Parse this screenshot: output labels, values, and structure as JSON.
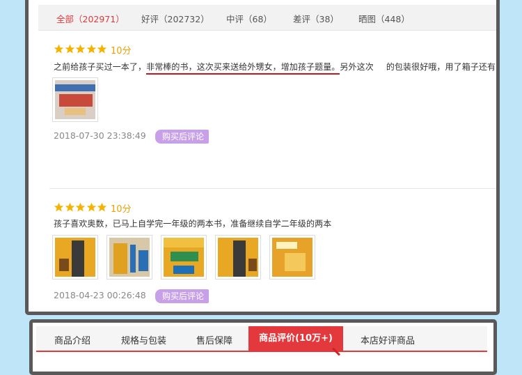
{
  "filters": [
    {
      "label": "全部（202971）",
      "active": true
    },
    {
      "label": "好评（202732）"
    },
    {
      "label": "中评（68）"
    },
    {
      "label": "差评（38）"
    },
    {
      "label": "晒图（448）"
    }
  ],
  "reviews": [
    {
      "score": "10分",
      "text_before": "之前给孩子买过一本了，",
      "text_highlight": "非常棒的书，这次买来送给外甥女，增加孩子题量。",
      "text_after": "另外这次",
      "text_after2": "的包装很好哦，用了箱子还有防",
      "date": "2018-07-30 23:38:49",
      "badge": "购买后评论"
    },
    {
      "score": "10分",
      "text": "孩子喜欢奥数，已马上自学完一年级的两本书，准备继续自学二年级的两本",
      "date": "2018-04-23 00:26:48",
      "badge": "购买后评论"
    }
  ],
  "tabs": [
    {
      "label": "商品介绍"
    },
    {
      "label": "规格与包装"
    },
    {
      "label": "售后保障"
    },
    {
      "label": "商品评价(10万+)",
      "active": true
    },
    {
      "label": "本店好评商品"
    }
  ],
  "colors": {
    "accent": "#e4393c",
    "star": "#f5b301",
    "badge": "#c8a0e8",
    "background": "#bfe6f8"
  }
}
